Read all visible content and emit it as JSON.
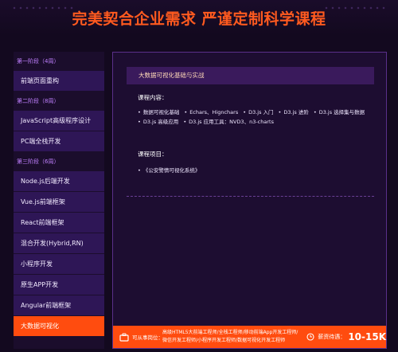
{
  "headline": "完美契合企业需求 严谨定制科学课程",
  "sidebar": {
    "stages": [
      {
        "label": "第一阶段（4周）",
        "courses": [
          "前端页面重构"
        ]
      },
      {
        "label": "第二阶段（8周）",
        "courses": [
          "JavaScript高级程序设计",
          "PC端全栈开发"
        ]
      },
      {
        "label": "第三阶段（6周）",
        "courses": [
          "Node.js后端开发",
          "Vue.js前端框架",
          "React前端框架",
          "混合开发(Hybrid,RN)",
          "小程序开发",
          "原生APP开发",
          "Angular前端框架",
          "大数据可视化"
        ]
      }
    ],
    "active_course": "大数据可视化"
  },
  "panel": {
    "title": "大数据可视化基础与实战",
    "content_label": "课程内容：",
    "content_items": [
      "数据可视化基础",
      "Echars、Hignchars",
      "D3.js 入门",
      "D3.js 进阶",
      "D3.js 选择集与数据",
      "D3.js 高级应用",
      "D3.js 应用工具：NVD3、n3-charts"
    ],
    "project_label": "课程项目：",
    "project_items": [
      "《公安警情可视化系统》"
    ]
  },
  "footer": {
    "jobs_label": "可从事岗位：",
    "jobs": "高级HTML5大前端工程师/全栈工程师/移动前端App开发工程师/微信开发工程师/小程序开发工程师/数据可视化开发工程师",
    "salary_label": "薪资待遇：",
    "salary": "10-15K"
  },
  "colors": {
    "accent": "#ff4c0f",
    "tab": "#2e1656",
    "stage_label": "#c080ff",
    "background": "#13091f"
  },
  "icons": [
    "briefcase-icon",
    "clock-icon"
  ]
}
